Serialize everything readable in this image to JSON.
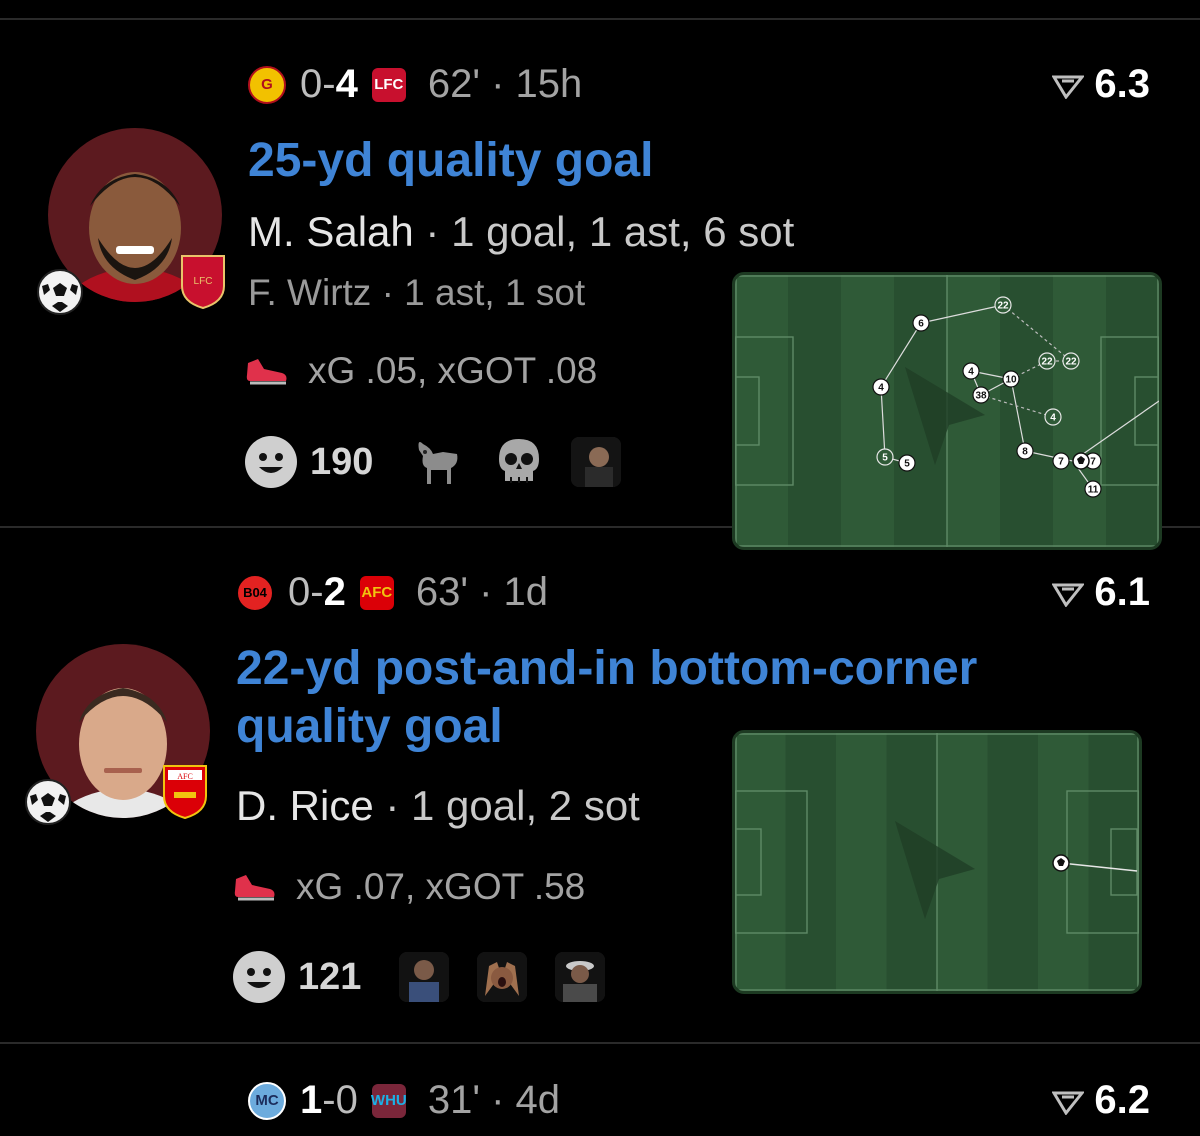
{
  "feed": {
    "cards": [
      {
        "home_crest": "galatasaray-crest",
        "score_home": "0-",
        "score_away": "4",
        "away_crest": "liverpool-crest",
        "minute_time": "62' · 15h",
        "rating": "6.3",
        "title": "25-yd quality goal",
        "player_name": "M. Salah",
        "player_stats": " · 1 goal, 1 ast, 6 sot",
        "assist_line": "F. Wirtz · 1 ast, 1 sot",
        "xg_line": "xG .05, xGOT .08",
        "reaction_count": "190",
        "reactions": [
          "goat-emoji",
          "skull-emoji",
          "reaction-sticker"
        ],
        "avatar": "salah-avatar",
        "club_badge": "liverpool-badge"
      },
      {
        "home_crest": "leverkusen-crest",
        "score_home": "0-",
        "score_away": "2",
        "away_crest": "arsenal-crest",
        "minute_time": "63' · 1d",
        "rating": "6.1",
        "title": "22-yd post-and-in bottom-corner quality goal",
        "player_name": "D. Rice",
        "player_stats": " · 1 goal, 2 sot",
        "xg_line": "xG .07, xGOT .58",
        "reaction_count": "121",
        "reactions": [
          "reaction-sticker-1",
          "reaction-sticker-2",
          "reaction-sticker-3"
        ],
        "avatar": "rice-avatar",
        "club_badge": "arsenal-badge"
      },
      {
        "home_crest": "man-city-crest",
        "score_home": "1",
        "score_away": "-0",
        "away_crest": "west-ham-crest",
        "minute_time": "31' · 4d",
        "rating": "6.2"
      }
    ],
    "pitch1_passes": [
      "6",
      "22",
      "4",
      "4",
      "10",
      "22",
      "22",
      "38",
      "4",
      "8",
      "5",
      "5",
      "7",
      "7",
      "11"
    ],
    "colors": {
      "title_blue": "#3f84d6",
      "pitch_light": "#2f5a37",
      "pitch_dark": "#284f30",
      "background": "#000000"
    }
  }
}
